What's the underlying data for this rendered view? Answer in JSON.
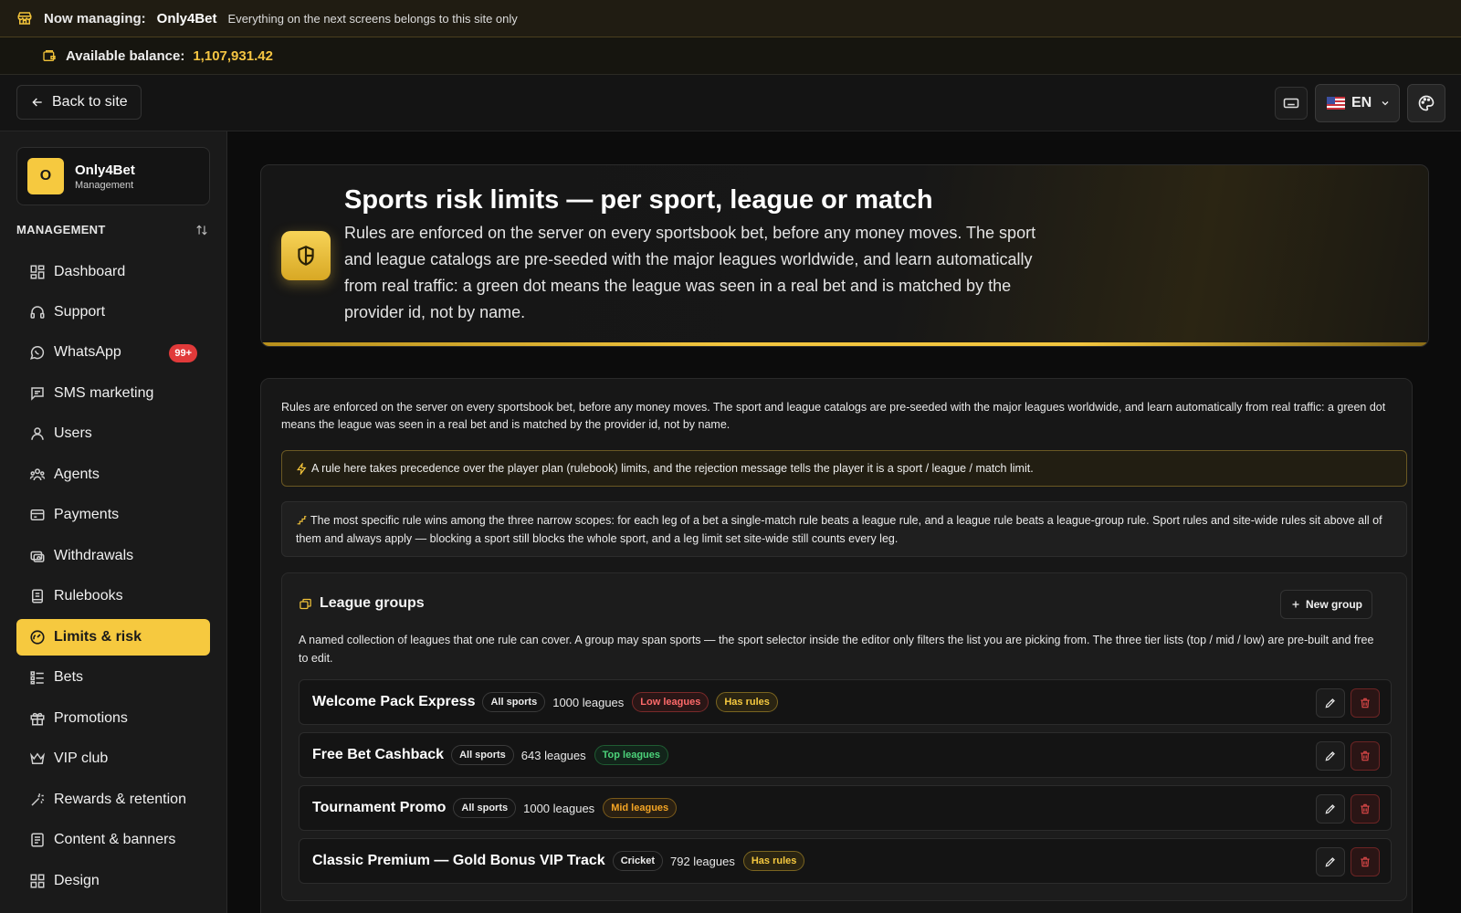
{
  "banner": {
    "label": "Now managing:",
    "site": "Only4Bet",
    "note": "Everything on the next screens belongs to this site only"
  },
  "balance": {
    "label": "Available balance:",
    "value": "1,107,931.42"
  },
  "topbar": {
    "back_label": "Back to site",
    "lang": "EN"
  },
  "brand": {
    "initial": "O",
    "name": "Only4Bet",
    "sub": "Management"
  },
  "sidebar": {
    "section": "MANAGEMENT",
    "items": [
      {
        "label": "Dashboard",
        "icon": "dashboard-icon"
      },
      {
        "label": "Support",
        "icon": "headset-icon"
      },
      {
        "label": "WhatsApp",
        "icon": "whatsapp-icon",
        "badge": "99+"
      },
      {
        "label": "SMS marketing",
        "icon": "message-icon"
      },
      {
        "label": "Users",
        "icon": "users-icon"
      },
      {
        "label": "Agents",
        "icon": "agents-icon"
      },
      {
        "label": "Payments",
        "icon": "card-icon"
      },
      {
        "label": "Withdrawals",
        "icon": "withdraw-icon"
      },
      {
        "label": "Rulebooks",
        "icon": "book-icon"
      },
      {
        "label": "Limits & risk",
        "icon": "gauge-icon",
        "active": true
      },
      {
        "label": "Bets",
        "icon": "list-icon"
      },
      {
        "label": "Promotions",
        "icon": "gift-icon"
      },
      {
        "label": "VIP club",
        "icon": "crown-icon"
      },
      {
        "label": "Rewards & retention",
        "icon": "sparkle-icon"
      },
      {
        "label": "Content & banners",
        "icon": "content-icon"
      },
      {
        "label": "Design",
        "icon": "design-icon"
      }
    ]
  },
  "hero": {
    "title": "Sports risk limits — per sport, league or match",
    "desc": "Rules are enforced on the server on every sportsbook bet, before any money moves. The sport and league catalogs are pre-seeded with the major leagues worldwide, and learn automatically from real traffic: a green dot means the league was seen in a real bet and is matched by the provider id, not by name."
  },
  "panel": {
    "intro": "Rules are enforced on the server on every sportsbook bet, before any money moves. The sport and league catalogs are pre-seeded with the major leagues worldwide, and learn automatically from real traffic: a green dot means the league was seen in a real bet and is matched by the provider id, not by name.",
    "notice": "A rule here takes precedence over the player plan (rulebook) limits, and the rejection message tells the player it is a sport / league / match limit.",
    "info": "The most specific rule wins among the three narrow scopes: for each leg of a bet a single-match rule beats a league rule, and a league rule beats a league-group rule. Sport rules and site-wide rules sit above all of them and always apply — blocking a sport still blocks the whole sport, and a leg limit set site-wide still counts every leg."
  },
  "groups": {
    "title": "League groups",
    "new_label": "New group",
    "desc": "A named collection of leagues that one rule can cover. A group may span sports — the sport selector inside the editor only filters the list you are picking from. The three tier lists (top / mid / low) are pre-built and free to edit.",
    "rows": [
      {
        "name": "Welcome Pack Express",
        "sport": "All sports",
        "count": "1000 leagues",
        "tag": "Low leagues",
        "tag_kind": "low",
        "rules": "Has rules"
      },
      {
        "name": "Free Bet Cashback",
        "sport": "All sports",
        "count": "643 leagues",
        "tag": "Top leagues",
        "tag_kind": "top",
        "rules": ""
      },
      {
        "name": "Tournament Promo",
        "sport": "All sports",
        "count": "1000 leagues",
        "tag": "Mid leagues",
        "tag_kind": "mid",
        "rules": ""
      },
      {
        "name": "Classic Premium — Gold Bonus VIP Track",
        "sport": "Cricket",
        "count": "792 leagues",
        "tag": "",
        "tag_kind": "",
        "rules": "Has rules"
      }
    ]
  },
  "colors": {
    "accent": "#f6c93f",
    "background": "#0c0c0c",
    "danger": "#e04949",
    "success": "#4cd37a"
  }
}
